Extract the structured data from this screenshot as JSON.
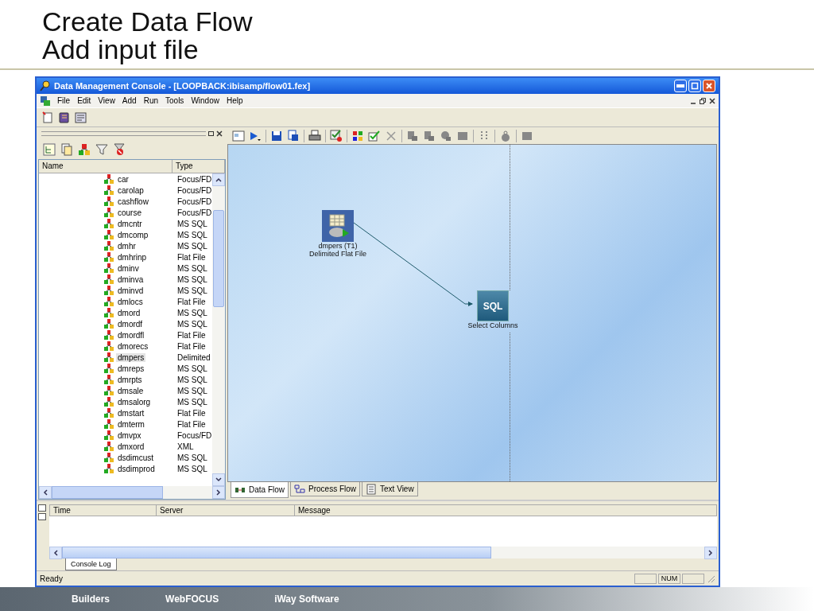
{
  "slide": {
    "title_lines": [
      "Create Data Flow",
      "Add input file"
    ]
  },
  "window": {
    "title": "Data Management Console - [LOOPBACK:ibisamp/flow01.fex]"
  },
  "menu": [
    "File",
    "Edit",
    "View",
    "Add",
    "Run",
    "Tools",
    "Window",
    "Help"
  ],
  "tree": {
    "columns": [
      "Name",
      "Type"
    ],
    "rows": [
      {
        "name": "car",
        "type": "Focus/FD",
        "selected": false
      },
      {
        "name": "carolap",
        "type": "Focus/FD",
        "selected": false
      },
      {
        "name": "cashflow",
        "type": "Focus/FD",
        "selected": false
      },
      {
        "name": "course",
        "type": "Focus/FD",
        "selected": false
      },
      {
        "name": "dmcntr",
        "type": "MS SQL",
        "selected": false
      },
      {
        "name": "dmcomp",
        "type": "MS SQL",
        "selected": false
      },
      {
        "name": "dmhr",
        "type": "MS SQL",
        "selected": false
      },
      {
        "name": "dmhrinp",
        "type": "Flat File",
        "selected": false
      },
      {
        "name": "dminv",
        "type": "MS SQL",
        "selected": false
      },
      {
        "name": "dminva",
        "type": "MS SQL",
        "selected": false
      },
      {
        "name": "dminvd",
        "type": "MS SQL",
        "selected": false
      },
      {
        "name": "dmlocs",
        "type": "Flat File",
        "selected": false
      },
      {
        "name": "dmord",
        "type": "MS SQL",
        "selected": false
      },
      {
        "name": "dmordf",
        "type": "MS SQL",
        "selected": false
      },
      {
        "name": "dmordfl",
        "type": "Flat File",
        "selected": false
      },
      {
        "name": "dmorecs",
        "type": "Flat File",
        "selected": false
      },
      {
        "name": "dmpers",
        "type": "Delimited",
        "selected": true
      },
      {
        "name": "dmreps",
        "type": "MS SQL",
        "selected": false
      },
      {
        "name": "dmrpts",
        "type": "MS SQL",
        "selected": false
      },
      {
        "name": "dmsale",
        "type": "MS SQL",
        "selected": false
      },
      {
        "name": "dmsalorg",
        "type": "MS SQL",
        "selected": false
      },
      {
        "name": "dmstart",
        "type": "Flat File",
        "selected": false
      },
      {
        "name": "dmterm",
        "type": "Flat File",
        "selected": false
      },
      {
        "name": "dmvpx",
        "type": "Focus/FD",
        "selected": false
      },
      {
        "name": "dmxord",
        "type": "XML",
        "selected": false
      },
      {
        "name": "dsdimcust",
        "type": "MS SQL",
        "selected": false
      },
      {
        "name": "dsdimprod",
        "type": "MS SQL",
        "selected": false
      }
    ]
  },
  "canvas": {
    "nodes": [
      {
        "kind": "file",
        "label": "dmpers (T1)",
        "sublabel": "Delimited Flat File"
      },
      {
        "kind": "sql",
        "icon_text": "SQL",
        "label": "Select Columns"
      }
    ]
  },
  "canvas_tabs": [
    {
      "label": "Data Flow",
      "selected": true
    },
    {
      "label": "Process Flow",
      "selected": false
    },
    {
      "label": "Text View",
      "selected": false
    }
  ],
  "console": {
    "columns": [
      "Time",
      "Server",
      "Message"
    ],
    "tabs": [
      {
        "label": "Console Log",
        "selected": true
      }
    ]
  },
  "status_bar": {
    "message": "Ready",
    "indicators": [
      "NUM"
    ]
  },
  "footer": [
    "Builders",
    "WebFOCUS",
    "iWay Software"
  ]
}
